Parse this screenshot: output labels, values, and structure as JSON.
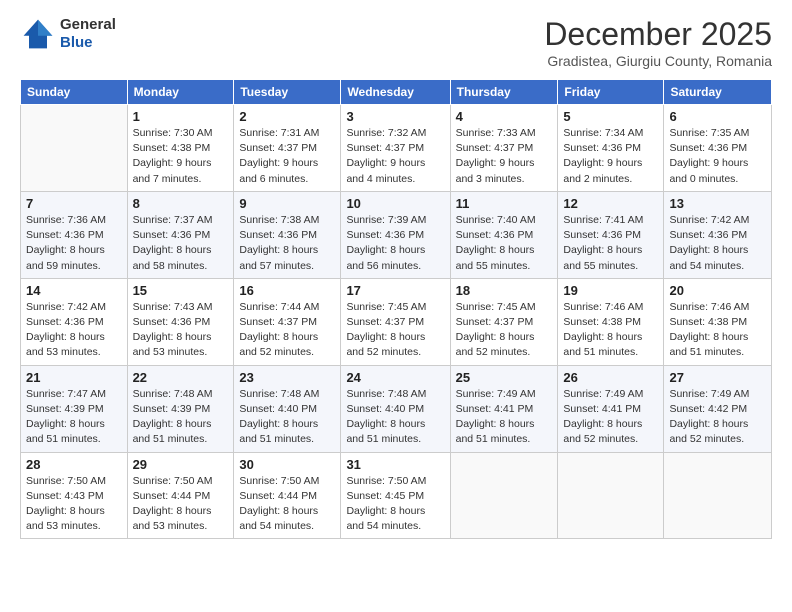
{
  "logo": {
    "line1": "General",
    "line2": "Blue"
  },
  "header": {
    "month": "December 2025",
    "location": "Gradistea, Giurgiu County, Romania"
  },
  "weekdays": [
    "Sunday",
    "Monday",
    "Tuesday",
    "Wednesday",
    "Thursday",
    "Friday",
    "Saturday"
  ],
  "weeks": [
    [
      {
        "day": "",
        "info": ""
      },
      {
        "day": "1",
        "info": "Sunrise: 7:30 AM\nSunset: 4:38 PM\nDaylight: 9 hours\nand 7 minutes."
      },
      {
        "day": "2",
        "info": "Sunrise: 7:31 AM\nSunset: 4:37 PM\nDaylight: 9 hours\nand 6 minutes."
      },
      {
        "day": "3",
        "info": "Sunrise: 7:32 AM\nSunset: 4:37 PM\nDaylight: 9 hours\nand 4 minutes."
      },
      {
        "day": "4",
        "info": "Sunrise: 7:33 AM\nSunset: 4:37 PM\nDaylight: 9 hours\nand 3 minutes."
      },
      {
        "day": "5",
        "info": "Sunrise: 7:34 AM\nSunset: 4:36 PM\nDaylight: 9 hours\nand 2 minutes."
      },
      {
        "day": "6",
        "info": "Sunrise: 7:35 AM\nSunset: 4:36 PM\nDaylight: 9 hours\nand 0 minutes."
      }
    ],
    [
      {
        "day": "7",
        "info": "Sunrise: 7:36 AM\nSunset: 4:36 PM\nDaylight: 8 hours\nand 59 minutes."
      },
      {
        "day": "8",
        "info": "Sunrise: 7:37 AM\nSunset: 4:36 PM\nDaylight: 8 hours\nand 58 minutes."
      },
      {
        "day": "9",
        "info": "Sunrise: 7:38 AM\nSunset: 4:36 PM\nDaylight: 8 hours\nand 57 minutes."
      },
      {
        "day": "10",
        "info": "Sunrise: 7:39 AM\nSunset: 4:36 PM\nDaylight: 8 hours\nand 56 minutes."
      },
      {
        "day": "11",
        "info": "Sunrise: 7:40 AM\nSunset: 4:36 PM\nDaylight: 8 hours\nand 55 minutes."
      },
      {
        "day": "12",
        "info": "Sunrise: 7:41 AM\nSunset: 4:36 PM\nDaylight: 8 hours\nand 55 minutes."
      },
      {
        "day": "13",
        "info": "Sunrise: 7:42 AM\nSunset: 4:36 PM\nDaylight: 8 hours\nand 54 minutes."
      }
    ],
    [
      {
        "day": "14",
        "info": "Sunrise: 7:42 AM\nSunset: 4:36 PM\nDaylight: 8 hours\nand 53 minutes."
      },
      {
        "day": "15",
        "info": "Sunrise: 7:43 AM\nSunset: 4:36 PM\nDaylight: 8 hours\nand 53 minutes."
      },
      {
        "day": "16",
        "info": "Sunrise: 7:44 AM\nSunset: 4:37 PM\nDaylight: 8 hours\nand 52 minutes."
      },
      {
        "day": "17",
        "info": "Sunrise: 7:45 AM\nSunset: 4:37 PM\nDaylight: 8 hours\nand 52 minutes."
      },
      {
        "day": "18",
        "info": "Sunrise: 7:45 AM\nSunset: 4:37 PM\nDaylight: 8 hours\nand 52 minutes."
      },
      {
        "day": "19",
        "info": "Sunrise: 7:46 AM\nSunset: 4:38 PM\nDaylight: 8 hours\nand 51 minutes."
      },
      {
        "day": "20",
        "info": "Sunrise: 7:46 AM\nSunset: 4:38 PM\nDaylight: 8 hours\nand 51 minutes."
      }
    ],
    [
      {
        "day": "21",
        "info": "Sunrise: 7:47 AM\nSunset: 4:39 PM\nDaylight: 8 hours\nand 51 minutes."
      },
      {
        "day": "22",
        "info": "Sunrise: 7:48 AM\nSunset: 4:39 PM\nDaylight: 8 hours\nand 51 minutes."
      },
      {
        "day": "23",
        "info": "Sunrise: 7:48 AM\nSunset: 4:40 PM\nDaylight: 8 hours\nand 51 minutes."
      },
      {
        "day": "24",
        "info": "Sunrise: 7:48 AM\nSunset: 4:40 PM\nDaylight: 8 hours\nand 51 minutes."
      },
      {
        "day": "25",
        "info": "Sunrise: 7:49 AM\nSunset: 4:41 PM\nDaylight: 8 hours\nand 51 minutes."
      },
      {
        "day": "26",
        "info": "Sunrise: 7:49 AM\nSunset: 4:41 PM\nDaylight: 8 hours\nand 52 minutes."
      },
      {
        "day": "27",
        "info": "Sunrise: 7:49 AM\nSunset: 4:42 PM\nDaylight: 8 hours\nand 52 minutes."
      }
    ],
    [
      {
        "day": "28",
        "info": "Sunrise: 7:50 AM\nSunset: 4:43 PM\nDaylight: 8 hours\nand 53 minutes."
      },
      {
        "day": "29",
        "info": "Sunrise: 7:50 AM\nSunset: 4:44 PM\nDaylight: 8 hours\nand 53 minutes."
      },
      {
        "day": "30",
        "info": "Sunrise: 7:50 AM\nSunset: 4:44 PM\nDaylight: 8 hours\nand 54 minutes."
      },
      {
        "day": "31",
        "info": "Sunrise: 7:50 AM\nSunset: 4:45 PM\nDaylight: 8 hours\nand 54 minutes."
      },
      {
        "day": "",
        "info": ""
      },
      {
        "day": "",
        "info": ""
      },
      {
        "day": "",
        "info": ""
      }
    ]
  ]
}
